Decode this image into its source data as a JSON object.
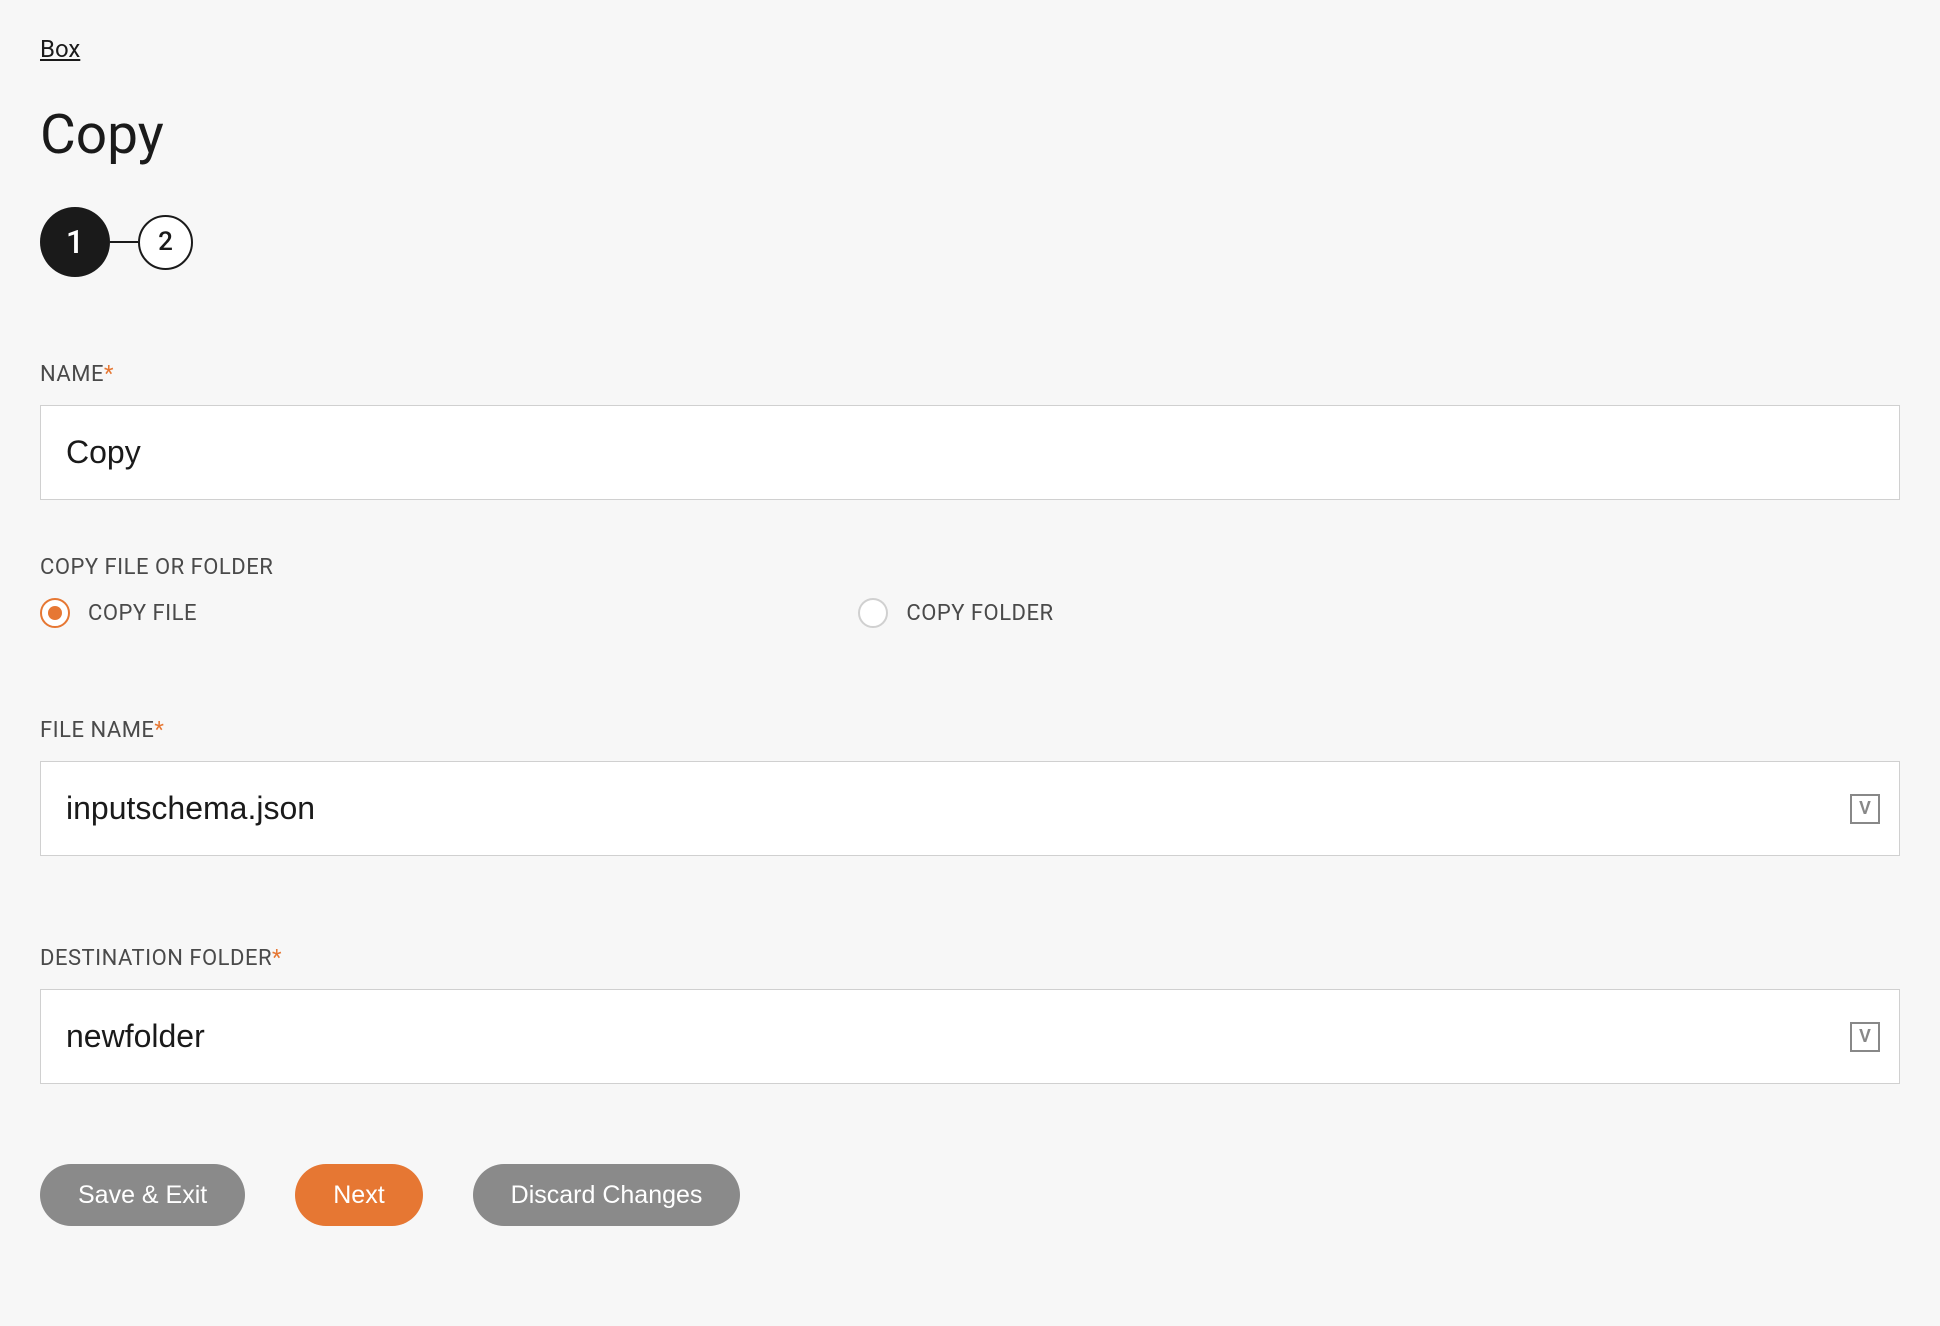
{
  "breadcrumb": {
    "link_text": "Box"
  },
  "page": {
    "title": "Copy"
  },
  "stepper": {
    "steps": [
      "1",
      "2"
    ],
    "active_index": 0
  },
  "form": {
    "name": {
      "label": "NAME",
      "required": "*",
      "value": "Copy"
    },
    "copy_type": {
      "label": "COPY FILE OR FOLDER",
      "options": [
        {
          "label": "COPY FILE",
          "selected": true
        },
        {
          "label": "COPY FOLDER",
          "selected": false
        }
      ]
    },
    "file_name": {
      "label": "FILE NAME",
      "required": "*",
      "value": "inputschema.json",
      "variable_badge": "V"
    },
    "destination_folder": {
      "label": "DESTINATION FOLDER",
      "required": "*",
      "value": "newfolder",
      "variable_badge": "V"
    }
  },
  "buttons": {
    "save_exit": "Save & Exit",
    "next": "Next",
    "discard": "Discard Changes"
  }
}
